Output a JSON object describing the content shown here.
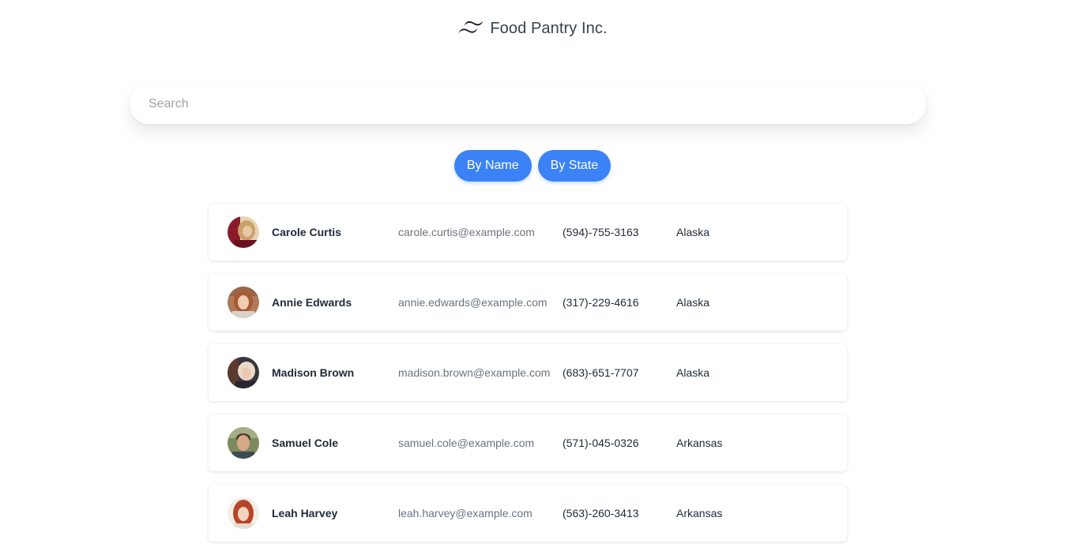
{
  "brand": {
    "name": "Food Pantry Inc.",
    "logo_icon": "tailwind-wave-icon"
  },
  "search": {
    "placeholder": "Search",
    "value": ""
  },
  "sort_buttons": [
    {
      "label": "By Name"
    },
    {
      "label": "By State"
    }
  ],
  "colors": {
    "accent": "#3b82f6",
    "email_text": "#6b7280"
  },
  "people": [
    {
      "name": "Carole Curtis",
      "email": "carole.curtis@example.com",
      "phone": "(594)-755-3163",
      "state": "Alaska"
    },
    {
      "name": "Annie Edwards",
      "email": "annie.edwards@example.com",
      "phone": "(317)-229-4616",
      "state": "Alaska"
    },
    {
      "name": "Madison Brown",
      "email": "madison.brown@example.com",
      "phone": "(683)-651-7707",
      "state": "Alaska"
    },
    {
      "name": "Samuel Cole",
      "email": "samuel.cole@example.com",
      "phone": "(571)-045-0326",
      "state": "Arkansas"
    },
    {
      "name": "Leah Harvey",
      "email": "leah.harvey@example.com",
      "phone": "(563)-260-3413",
      "state": "Arkansas"
    }
  ]
}
